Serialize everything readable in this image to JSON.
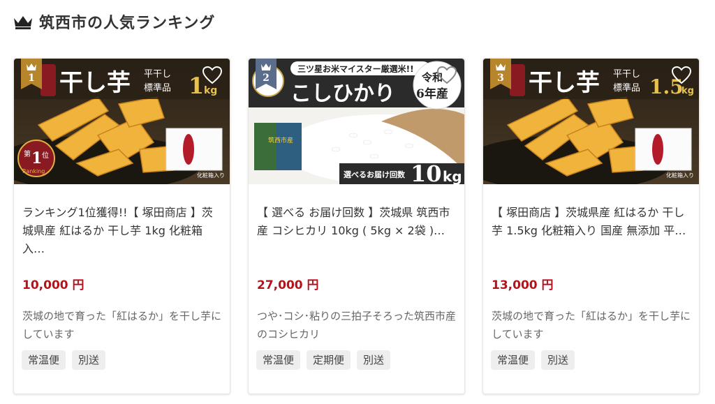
{
  "section": {
    "title": "筑西市の人気ランキング"
  },
  "products": [
    {
      "rank": "1",
      "rank_color": "#b7852c",
      "title": "ランキング1位獲得!!【 塚田商店 】茨城県産 紅はるか 干し芋 1kg 化粧箱入…",
      "price": "10,000 円",
      "description": "茨城の地で育った「紅はるか」を干し芋にしています",
      "tags": [
        "常温便",
        "別送"
      ],
      "image": {
        "name": "干し芋",
        "sub1": "平干し",
        "sub2": "標準品",
        "weight": "1",
        "unit": "kg",
        "box": "化粧箱入り",
        "box_label": "干しいも",
        "award_top": "第",
        "award_num": "1",
        "award_tail": "位",
        "award_en": "Ranking"
      }
    },
    {
      "rank": "2",
      "rank_color": "#5a6e8c",
      "title": "【 選べる お届け回数 】茨城県 筑西市産 コシヒカリ 10kg ( 5kg × 2袋 )…",
      "price": "27,000 円",
      "description": "つや･コシ･粘りの三拍子そろった筑西市産のコシヒカリ",
      "tags": [
        "常温便",
        "定期便",
        "別送"
      ],
      "image": {
        "banner": "三ツ星お米マイスター厳選米!!",
        "name": "こしひかり",
        "era": "令和",
        "year": "6年産",
        "select": "選べるお届け回数",
        "weight": "10",
        "unit": "kg",
        "bag_label": "筑西市産"
      }
    },
    {
      "rank": "3",
      "rank_color": "#b7852c",
      "title": "【 塚田商店 】茨城県産 紅はるか 干し芋 1.5kg 化粧箱入り 国産 無添加 平…",
      "price": "13,000 円",
      "description": "茨城の地で育った「紅はるか」を干し芋にしています",
      "tags": [
        "常温便",
        "別送"
      ],
      "image": {
        "name": "干し芋",
        "sub1": "平干し",
        "sub2": "標準品",
        "weight": "1.5",
        "unit": "kg",
        "box": "化粧箱入り",
        "box_label": "干しいも"
      }
    }
  ]
}
